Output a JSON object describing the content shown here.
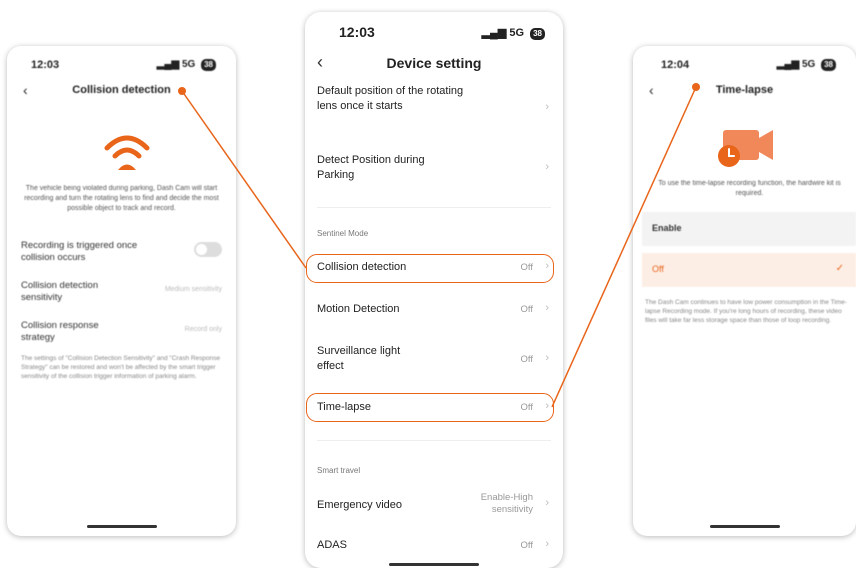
{
  "colors": {
    "accent": "#e8651a",
    "text": "#222222",
    "muted": "#999999"
  },
  "left_phone": {
    "time": "12:03",
    "signal": "5G",
    "battery": "38",
    "title": "Collision detection",
    "icon": "wifi-warning-icon",
    "description": "The vehicle being violated during parking, Dash Cam will start recording and turn the rotating lens to find and decide the most possible object to track and record.",
    "recording_label": "Recording is triggered once collision occurs",
    "sensitivity_label": "Collision detection sensitivity",
    "sensitivity_value": "Medium sensitivity",
    "response_label": "Collision response strategy",
    "response_value": "Record only",
    "note": "The settings of \"Collision Detection Sensitivity\" and \"Crash Response Strategy\" can be restored and won't be affected by the smart trigger sensitivity of the collision trigger information of parking alarm."
  },
  "center_phone": {
    "time": "12:03",
    "signal": "5G",
    "battery": "38",
    "title": "Device setting",
    "rows": [
      {
        "label": "Default position of the rotating lens once it starts",
        "value": ""
      },
      {
        "label": "Detect Position during Parking",
        "value": ""
      }
    ],
    "section_sentinel": "Sentinel Mode",
    "sentinel_rows": [
      {
        "label": "Collision detection",
        "value": "Off"
      },
      {
        "label": "Motion Detection",
        "value": "Off"
      },
      {
        "label": "Surveillance light effect",
        "value": "Off"
      },
      {
        "label": "Time-lapse",
        "value": "Off"
      }
    ],
    "section_travel": "Smart travel",
    "travel_rows": [
      {
        "label": "Emergency video",
        "value": "Enable-High sensitivity"
      },
      {
        "label": "ADAS",
        "value": "Off"
      }
    ]
  },
  "right_phone": {
    "time": "12:04",
    "signal": "5G",
    "battery": "38",
    "title": "Time-lapse",
    "icon": "video-clock-icon",
    "description": "To use the time-lapse recording function, the hardwire kit is required.",
    "option_enable": "Enable",
    "option_off": "Off",
    "note": "The Dash Cam continues to have low power consumption in the Time-lapse Recording mode. If you're long hours of recording, these video files will take far less storage space than those of loop recording."
  }
}
